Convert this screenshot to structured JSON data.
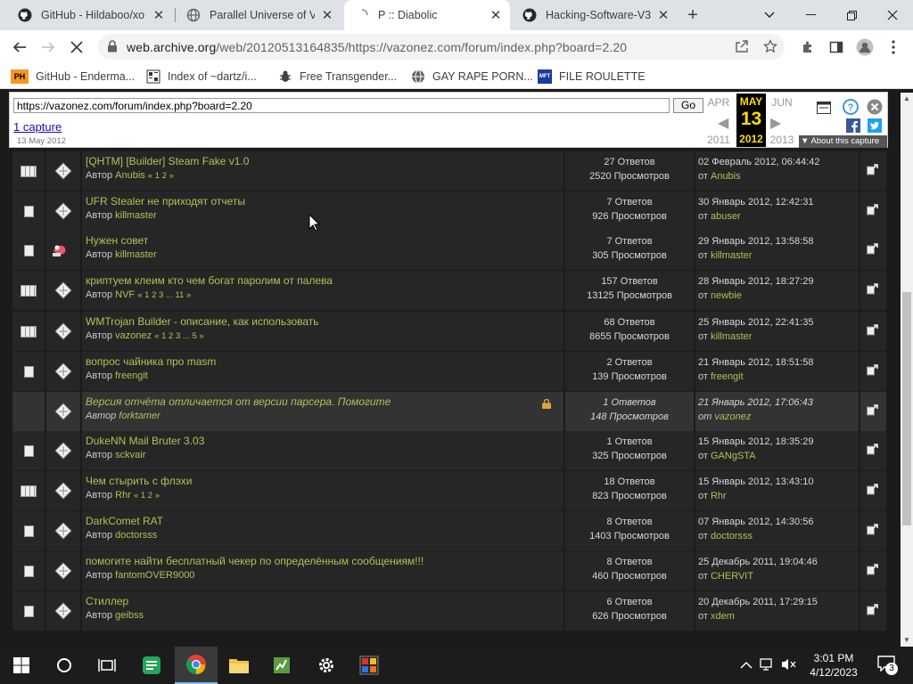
{
  "browser": {
    "tabs": [
      {
        "title": "GitHub - Hildaboo/xo",
        "icon": "github-icon"
      },
      {
        "title": "Parallel Universe of V",
        "icon": "globe-icon"
      },
      {
        "title": "P :: Diabolic",
        "icon": "loading-spinner-icon",
        "active": true
      },
      {
        "title": "Hacking-Software-V3",
        "icon": "github-icon"
      }
    ],
    "new_tab": "+",
    "url_domain": "web.archive.org",
    "url_path": "/web/20120513164835/https://vazonez.com/forum/index.php?board=2.20",
    "bookmarks": [
      {
        "label": "GitHub - Enderma...",
        "icon": "PH"
      },
      {
        "label": "Index of ~dartz/i...",
        "icon": "folder"
      },
      {
        "label": "Free Transgender...",
        "icon": "bug"
      },
      {
        "label": "GAY RAPE PORN...",
        "icon": "globe"
      },
      {
        "label": "FILE ROULETTE",
        "icon": "MFT"
      }
    ]
  },
  "wayback": {
    "url_value": "https://vazonez.com/forum/index.php?board=2.20",
    "go": "Go",
    "capture_link": "1 capture",
    "capture_date": "13 May 2012",
    "prev_month": "APR",
    "cur_month": "MAY",
    "next_month": "JUN",
    "cur_day": "13",
    "prev_year": "2011",
    "cur_year": "2012",
    "next_year": "2013",
    "about": "About this capture"
  },
  "forum": {
    "author_prefix": "Автор",
    "last_prefix": "от",
    "topics": [
      {
        "subject": "[QHTM] [Builder] Steam Fake v1.0",
        "author": "Anubis",
        "pages": "« 1 2 »",
        "replies": "27 Ответов",
        "views": "2520 Просмотров",
        "date": "02 Февраль 2012, 06:44:42",
        "last_by": "Anubis",
        "icon": "hot"
      },
      {
        "subject": "UFR Stealer не приходят отчеты",
        "author": "killmaster",
        "pages": "",
        "replies": "7 Ответов",
        "views": "926 Просмотров",
        "date": "30 Январь 2012, 12:42:31",
        "last_by": "abuser",
        "icon": "doc"
      },
      {
        "subject": "Нужен совет",
        "author": "killmaster",
        "pages": "",
        "replies": "7 Ответов",
        "views": "305 Просмотров",
        "date": "29 Январь 2012, 13:58:58",
        "last_by": "killmaster",
        "icon": "doc",
        "new": true
      },
      {
        "subject": "криптуем клеим кто чем богат паролим от палева",
        "author": "NVF",
        "pages": "« 1 2 3 ... 11 »",
        "replies": "157 Ответов",
        "views": "13125 Просмотров",
        "date": "28 Январь 2012, 18:27:29",
        "last_by": "newbie",
        "icon": "hot"
      },
      {
        "subject": "WMTrojan Builder - описание, как использовать",
        "author": "vazonez",
        "pages": "« 1 2 3 ... 5 »",
        "replies": "68 Ответов",
        "views": "8655 Просмотров",
        "date": "25 Январь 2012, 22:41:35",
        "last_by": "killmaster",
        "icon": "hot"
      },
      {
        "subject": "вопрос чайника про masm",
        "author": "freengit",
        "pages": "",
        "replies": "2 Ответов",
        "views": "139 Просмотров",
        "date": "21 Январь 2012, 18:51:58",
        "last_by": "freengit",
        "icon": "doc"
      },
      {
        "subject": "Версия отчёта отличается от версии парсера. Помогите",
        "author": "forktamer",
        "pages": "",
        "replies": "1 Ответов",
        "views": "148 Просмотров",
        "date": "21 Январь 2012, 17:06:43",
        "last_by": "vazonez",
        "icon": "none",
        "locked": true
      },
      {
        "subject": "DukeNN Mail Bruter 3.03",
        "author": "sckvair",
        "pages": "",
        "replies": "1 Ответов",
        "views": "325 Просмотров",
        "date": "15 Январь 2012, 18:35:29",
        "last_by": "GANgSTA",
        "icon": "doc"
      },
      {
        "subject": "Чем стырить с флэхи",
        "author": "Rhr",
        "pages": "« 1 2 »",
        "replies": "18 Ответов",
        "views": "823 Просмотров",
        "date": "15 Январь 2012, 13:43:10",
        "last_by": "Rhr",
        "icon": "hot"
      },
      {
        "subject": "DarkComet RAT",
        "author": "doctorsss",
        "pages": "",
        "replies": "8 Ответов",
        "views": "1403 Просмотров",
        "date": "07 Январь 2012, 14:30:56",
        "last_by": "doctorsss",
        "icon": "doc"
      },
      {
        "subject": "помогите найти бесплатный чекер по определённым сообщениям!!!",
        "author": "fantomOVER9000",
        "pages": "",
        "replies": "8 Ответов",
        "views": "460 Просмотров",
        "date": "25 Декабрь 2011, 19:04:46",
        "last_by": "CHERVIT",
        "icon": "doc"
      },
      {
        "subject": "Стиллер",
        "author": "geibss",
        "pages": "",
        "replies": "6 Ответов",
        "views": "626 Просмотров",
        "date": "20 Декабрь 2011, 17:29:15",
        "last_by": "xdem",
        "icon": "doc"
      }
    ]
  },
  "taskbar": {
    "time": "3:01 PM",
    "date": "4/12/2023",
    "notifications": "3"
  },
  "colors": {
    "link": "#b1c156",
    "row_bg": "#262626",
    "highlight_row": "#333333"
  }
}
